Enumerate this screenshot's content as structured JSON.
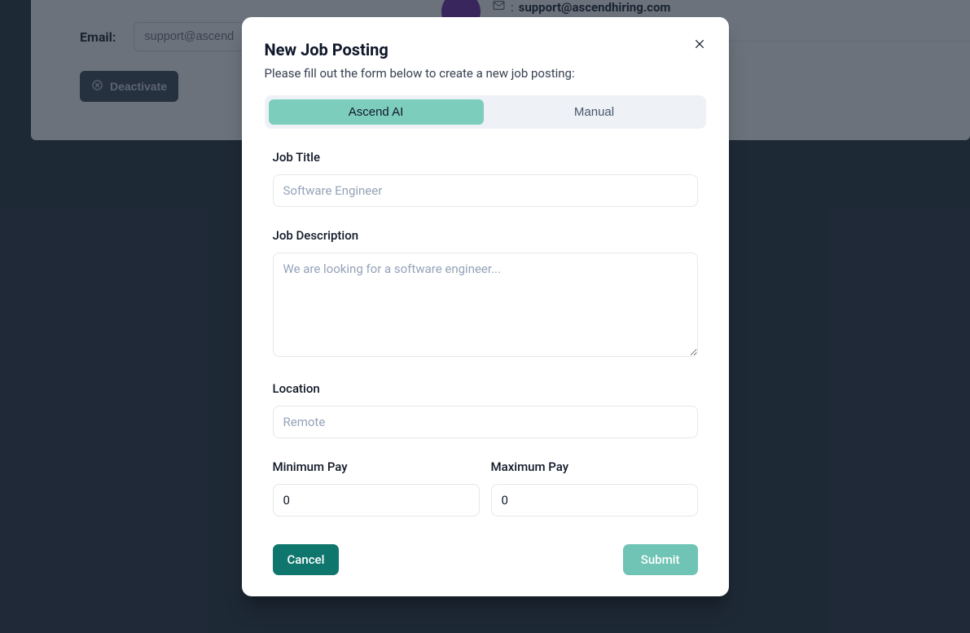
{
  "background": {
    "email_label": "Email:",
    "email_value": "support@ascend",
    "deactivate_label": "Deactivate",
    "display_email": "support@ascendhiring.com"
  },
  "modal": {
    "title": "New Job Posting",
    "subtitle": "Please fill out the form below to create a new job posting:",
    "tabs": {
      "ai": "Ascend AI",
      "manual": "Manual"
    },
    "fields": {
      "job_title": {
        "label": "Job Title",
        "placeholder": "Software Engineer",
        "value": ""
      },
      "job_description": {
        "label": "Job Description",
        "placeholder": "We are looking for a software engineer...",
        "value": ""
      },
      "location": {
        "label": "Location",
        "placeholder": "Remote",
        "value": ""
      },
      "min_pay": {
        "label": "Minimum Pay",
        "value": "0"
      },
      "max_pay": {
        "label": "Maximum Pay",
        "value": "0"
      }
    },
    "buttons": {
      "cancel": "Cancel",
      "submit": "Submit"
    }
  }
}
